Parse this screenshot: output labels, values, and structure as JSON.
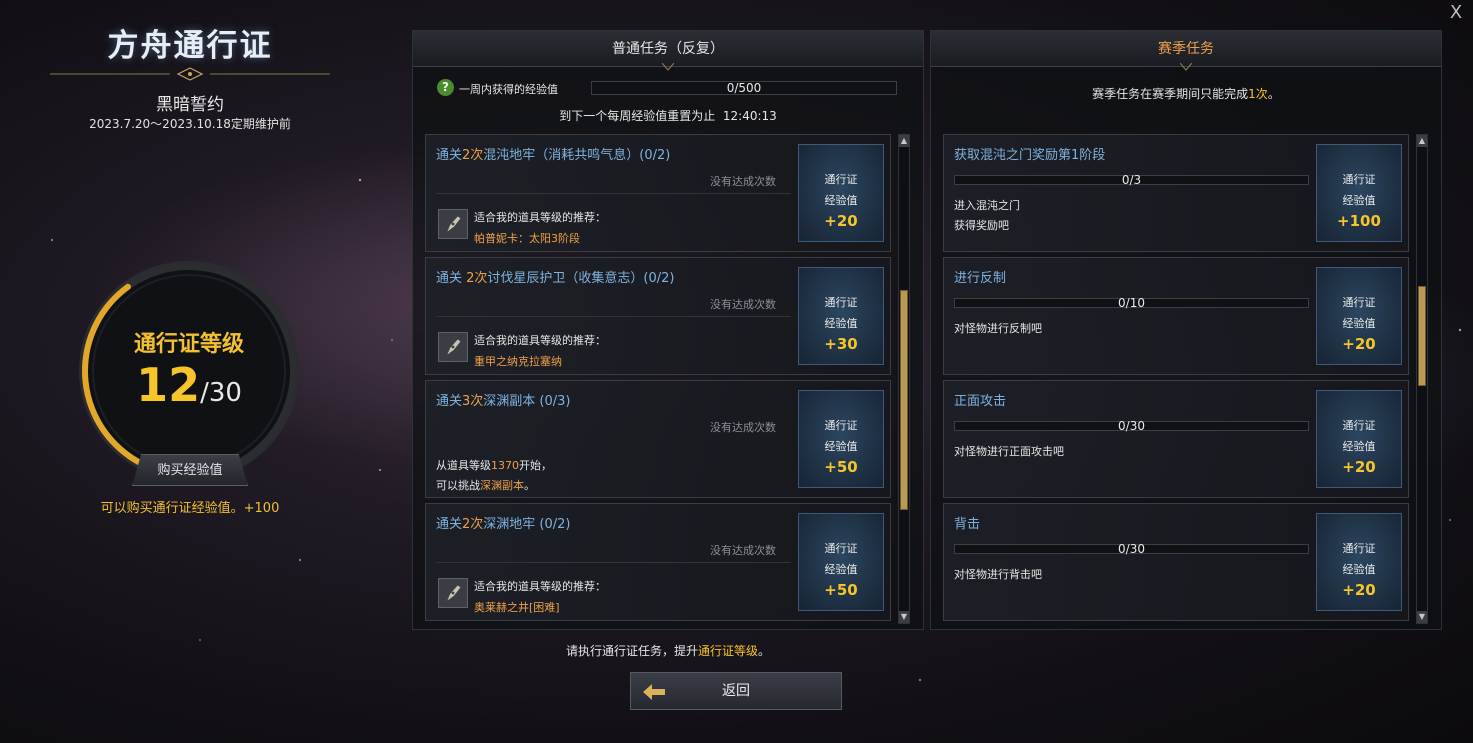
{
  "close_label": "X",
  "left": {
    "title": "方舟通行证",
    "season_name": "黑暗誓约",
    "season_dates": "2023.7.20～2023.10.18定期维护前",
    "level_label": "通行证等级",
    "level_current": "12",
    "level_max": "/30",
    "level_progress": 0.4,
    "buy_button": "购买经验值",
    "buy_hint": "可以购买通行证经验值。+100"
  },
  "normal": {
    "header": "普通任务（反复）",
    "help_icon": "?",
    "weekly_label": "一周内获得的经验值",
    "weekly_value": "0/500",
    "reset_text": "到下一个每周经验值重置为止",
    "reset_time": "12:40:13",
    "quests": [
      {
        "pre": "通关",
        "num": "2次",
        "name": "混沌地牢（消耗共鸣气息）(0/2)",
        "status": "没有达成次数",
        "rec_label": "适合我的道具等级的推荐：",
        "rec_value": "帕普妮卡：太阳3阶段",
        "reward_a": "通行证",
        "reward_b": "经验值",
        "reward_c": "+20"
      },
      {
        "pre": "通关 ",
        "num": "2次",
        "name": "讨伐星辰护卫（收集意志）(0/2)",
        "status": "没有达成次数",
        "rec_label": "适合我的道具等级的推荐：",
        "rec_value": "重甲之纳克拉塞纳",
        "reward_a": "通行证",
        "reward_b": "经验值",
        "reward_c": "+30"
      },
      {
        "pre": "通关",
        "num": "3次",
        "name": "深渊副本 (0/3)",
        "status": "没有达成次数",
        "line1_pre": "从道具等级",
        "line1_num": "1370",
        "line1_post": "开始，",
        "line2_pre": "可以挑战",
        "line2_hl": "深渊副本",
        "line2_post": "。",
        "reward_a": "通行证",
        "reward_b": "经验值",
        "reward_c": "+50"
      },
      {
        "pre": "通关",
        "num": "2次",
        "name": "深渊地牢 (0/2)",
        "status": "没有达成次数",
        "rec_label": "适合我的道具等级的推荐：",
        "rec_value": "奥莱赫之井[困难]",
        "reward_a": "通行证",
        "reward_b": "经验值",
        "reward_c": "+50"
      }
    ],
    "scroll_position": 0.58
  },
  "season": {
    "header": "赛季任务",
    "note_pre": "赛季任务在赛季期间只能完成",
    "note_hl": "1次",
    "note_post": "。",
    "quests": [
      {
        "title": "获取混沌之门奖励第1阶段",
        "progress": "0/3",
        "desc1": "进入混沌之门",
        "desc2": "获得奖励吧",
        "reward_a": "通行证",
        "reward_b": "经验值",
        "reward_c": "+100"
      },
      {
        "title": "进行反制",
        "progress": "0/10",
        "desc1": "对怪物进行反制吧",
        "desc2": "",
        "reward_a": "通行证",
        "reward_b": "经验值",
        "reward_c": "+20"
      },
      {
        "title": "正面攻击",
        "progress": "0/30",
        "desc1": "对怪物进行正面攻击吧",
        "desc2": "",
        "reward_a": "通行证",
        "reward_b": "经验值",
        "reward_c": "+20"
      },
      {
        "title": "背击",
        "progress": "0/30",
        "desc1": "对怪物进行背击吧",
        "desc2": "",
        "reward_a": "通行证",
        "reward_b": "经验值",
        "reward_c": "+20"
      }
    ],
    "scroll_position": 0.38
  },
  "footer": {
    "hint_pre": "请执行通行证任务，提升",
    "hint_hl": "通行证等级",
    "hint_post": "。",
    "back_label": "返回"
  },
  "colors": {
    "accent_gold": "#f6c52a",
    "quest_title_blue": "#7fb2de",
    "highlight_orange": "#f0a04a"
  }
}
